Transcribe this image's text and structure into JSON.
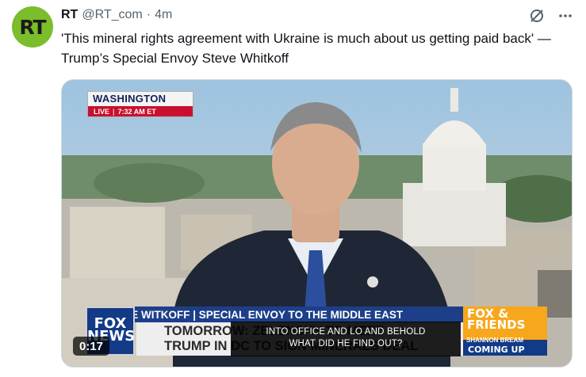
{
  "tweet": {
    "author_name": "RT",
    "handle": "@RT_com",
    "separator": "·",
    "time": "4m",
    "avatar_initials": "RT",
    "text": "'This mineral rights agreement with Ukraine is much about us getting paid back' — Trump’s Special Envoy Steve Whitkoff",
    "colors": {
      "avatar": "#7bbd2a",
      "text": "#0f1419",
      "muted": "#536471"
    }
  },
  "actions": [
    {
      "icon": "grok-icon"
    },
    {
      "icon": "more-icon"
    }
  ],
  "video": {
    "location": "WASHINGTON",
    "live_label": "LIVE",
    "live_time": "7:32 AM ET",
    "lower_third": "STEVE WITKOFF | SPECIAL ENVOY TO THE MIDDLE EAST",
    "headline_line1": "TOMORROW: ZELENSKY TO MEET",
    "headline_line2": "TRUMP IN DC TO SIGN MINERALS DEAL",
    "network_logo_line1": "FOX",
    "network_logo_line2": "NEWS",
    "show_logo_line1": "FOX &",
    "show_logo_line2": "FRIENDS",
    "up_next_host": "SHANNON BREAM",
    "up_next_label": "COMING UP",
    "caption_line1": "INTO OFFICE AND LO AND BEHOLD",
    "caption_line2": "WHAT DID HE FIND OUT?",
    "timestamp": "0:17",
    "colors": {
      "fox_blue": "#123a87",
      "live_red": "#c8102e",
      "friends_orange": "#f7a71c"
    }
  }
}
